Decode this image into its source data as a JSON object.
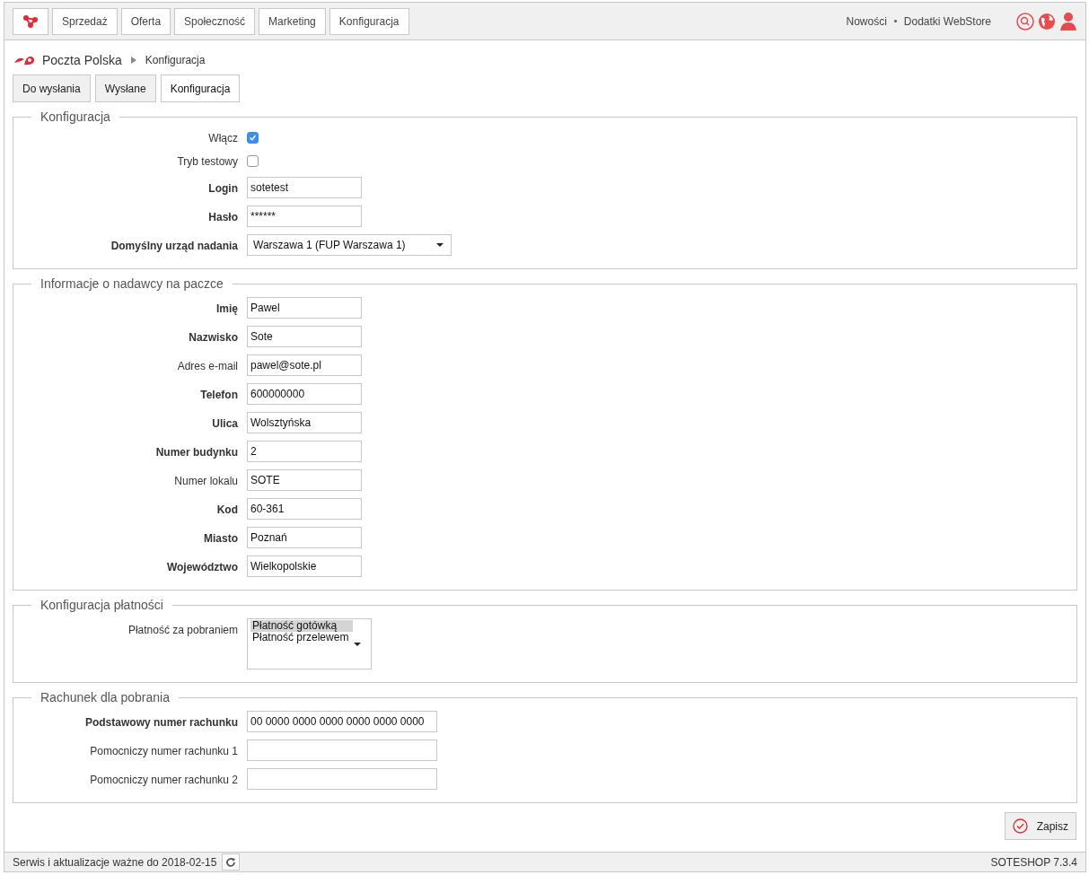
{
  "top_nav": {
    "items": [
      {
        "label": "Sprzedaż"
      },
      {
        "label": "Oferta"
      },
      {
        "label": "Społeczność"
      },
      {
        "label": "Marketing"
      },
      {
        "label": "Konfiguracja"
      }
    ],
    "links": [
      "Nowości",
      "Dodatki WebStore"
    ]
  },
  "breadcrumb": {
    "module": "Poczta Polska",
    "page": "Konfiguracja"
  },
  "tabs": [
    {
      "label": "Do wysłania",
      "selected": false
    },
    {
      "label": "Wysłane",
      "selected": false
    },
    {
      "label": "Konfiguracja",
      "selected": true
    }
  ],
  "sections": [
    {
      "legend": "Konfiguracja",
      "fields": [
        {
          "kind": "checkbox",
          "label": "Włącz",
          "required": false,
          "checked": true
        },
        {
          "kind": "checkbox",
          "label": "Tryb testowy",
          "required": false,
          "checked": false
        },
        {
          "kind": "text",
          "label": "Login",
          "required": true,
          "value": "sotetest"
        },
        {
          "kind": "text",
          "label": "Hasło",
          "required": true,
          "value": "******"
        },
        {
          "kind": "select",
          "label": "Domyślny urząd nadania",
          "required": true,
          "value": "Warszawa 1 (FUP Warszawa 1)"
        }
      ]
    },
    {
      "legend": "Informacje o nadawcy na paczce",
      "fields": [
        {
          "kind": "text",
          "label": "Imię",
          "required": true,
          "value": "Pawel"
        },
        {
          "kind": "text",
          "label": "Nazwisko",
          "required": true,
          "value": "Sote"
        },
        {
          "kind": "text",
          "label": "Adres e-mail",
          "required": false,
          "value": "pawel@sote.pl"
        },
        {
          "kind": "text",
          "label": "Telefon",
          "required": true,
          "value": "600000000"
        },
        {
          "kind": "text",
          "label": "Ulica",
          "required": true,
          "value": "Wolsztyńska"
        },
        {
          "kind": "text",
          "label": "Numer budynku",
          "required": true,
          "value": "2"
        },
        {
          "kind": "text",
          "label": "Numer lokalu",
          "required": false,
          "value": "SOTE"
        },
        {
          "kind": "text",
          "label": "Kod",
          "required": true,
          "value": "60-361"
        },
        {
          "kind": "text",
          "label": "Miasto",
          "required": true,
          "value": "Poznań"
        },
        {
          "kind": "text",
          "label": "Województwo",
          "required": true,
          "value": "Wielkopolskie"
        }
      ]
    },
    {
      "legend": "Konfiguracja płatności",
      "fields": [
        {
          "kind": "listbox",
          "label": "Płatność za pobraniem",
          "required": false,
          "options": [
            {
              "label": "Płatność gotówką",
              "selected": true
            },
            {
              "label": "Płatność przelewem",
              "selected": false
            }
          ]
        }
      ]
    },
    {
      "legend": "Rachunek dla pobrania",
      "fields": [
        {
          "kind": "wide",
          "label": "Podstawowy numer rachunku",
          "required": true,
          "value": "00 0000 0000 0000 0000 0000 0000"
        },
        {
          "kind": "wide",
          "label": "Pomocniczy numer rachunku 1",
          "required": false
        },
        {
          "kind": "wide",
          "label": "Pomocniczy numer rachunku 2",
          "required": false
        }
      ]
    }
  ],
  "save_button": "Zapisz",
  "footer": {
    "license": "Serwis i aktualizacje ważne do 2018-02-15",
    "version": "SOTESHOP 7.3.4"
  }
}
